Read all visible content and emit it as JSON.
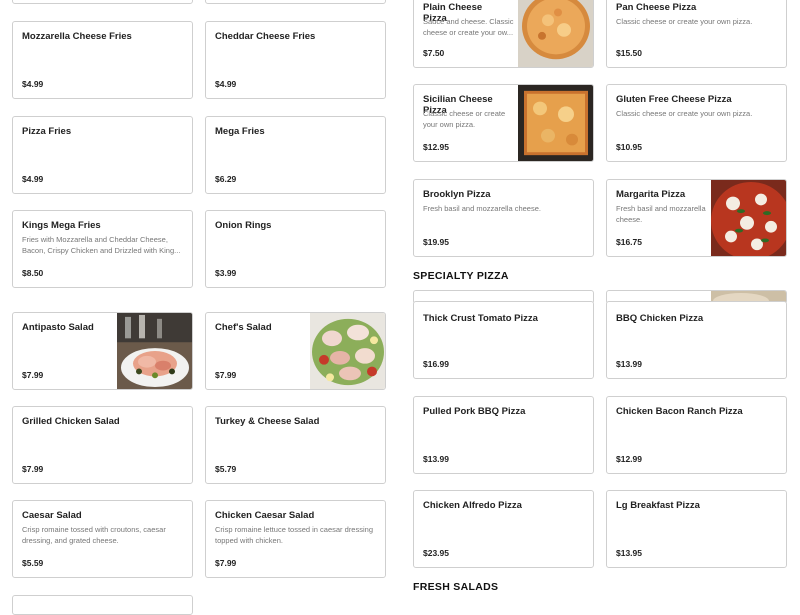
{
  "left_column": [
    {
      "id": "mozzarella-cheese-fries",
      "name": "Mozzarella Cheese Fries",
      "desc": "",
      "price": "$4.99"
    },
    {
      "id": "cheddar-cheese-fries",
      "name": "Cheddar Cheese Fries",
      "desc": "",
      "price": "$4.99"
    },
    {
      "id": "pizza-fries",
      "name": "Pizza Fries",
      "desc": "",
      "price": "$4.99"
    },
    {
      "id": "mega-fries",
      "name": "Mega Fries",
      "desc": "",
      "price": "$6.29"
    },
    {
      "id": "kings-mega-fries",
      "name": "Kings Mega Fries",
      "desc": "Fries with Mozzarella and Cheddar Cheese, Bacon, Crispy Chicken and Drizzled with King...",
      "price": "$8.50"
    },
    {
      "id": "onion-rings",
      "name": "Onion Rings",
      "desc": "",
      "price": "$3.99"
    },
    {
      "id": "antipasto-salad",
      "name": "Antipasto Salad",
      "desc": "",
      "price": "$7.99"
    },
    {
      "id": "chefs-salad",
      "name": "Chef's Salad",
      "desc": "",
      "price": "$7.99"
    },
    {
      "id": "grilled-chicken-salad",
      "name": "Grilled Chicken Salad",
      "desc": "",
      "price": "$7.99"
    },
    {
      "id": "turkey-cheese-salad",
      "name": "Turkey & Cheese Salad",
      "desc": "",
      "price": "$5.79"
    },
    {
      "id": "caesar-salad",
      "name": "Caesar Salad",
      "desc": "Crisp romaine tossed with croutons, caesar dressing, and grated cheese.",
      "price": "$5.59"
    },
    {
      "id": "chicken-caesar-salad",
      "name": "Chicken Caesar Salad",
      "desc": "Crisp romaine lettuce tossed in caesar dressing topped with chicken.",
      "price": "$7.99"
    }
  ],
  "right_column": [
    {
      "id": "plain-cheese-pizza",
      "name": "Plain Cheese Pizza",
      "desc": "Sauce and cheese. Classic cheese or create your ow...",
      "price": "$7.50"
    },
    {
      "id": "pan-cheese-pizza",
      "name": "Pan Cheese Pizza",
      "desc": "Classic cheese or create your own pizza.",
      "price": "$15.50"
    },
    {
      "id": "sicilian-cheese-pizza",
      "name": "Sicilian Cheese Pizza",
      "desc": "Classic cheese or create your own pizza.",
      "price": "$12.95"
    },
    {
      "id": "gluten-free-cheese-pizza",
      "name": "Gluten Free Cheese Pizza",
      "desc": "Classic cheese or create your own pizza.",
      "price": "$10.95"
    },
    {
      "id": "brooklyn-pizza",
      "name": "Brooklyn Pizza",
      "desc": "Fresh basil and mozzarella cheese.",
      "price": "$19.95"
    },
    {
      "id": "margarita-pizza",
      "name": "Margarita Pizza",
      "desc": "Fresh basil and mozzarella cheese.",
      "price": "$16.75"
    }
  ],
  "sections": {
    "specialty": "SPECIALTY PIZZA",
    "fresh_salads": "FRESH SALADS"
  },
  "specialty": [
    {
      "id": "thick-crust-tomato-pizza",
      "name": "Thick Crust Tomato Pizza",
      "price": "$16.99"
    },
    {
      "id": "bbq-chicken-pizza",
      "name": "BBQ Chicken Pizza",
      "price": "$13.99"
    },
    {
      "id": "pulled-pork-bbq-pizza",
      "name": "Pulled Pork BBQ Pizza",
      "price": "$13.99"
    },
    {
      "id": "chicken-bacon-ranch-pizza",
      "name": "Chicken Bacon Ranch Pizza",
      "price": "$12.99"
    },
    {
      "id": "chicken-alfredo-pizza",
      "name": "Chicken Alfredo Pizza",
      "price": "$23.95"
    },
    {
      "id": "lg-breakfast-pizza",
      "name": "Lg Breakfast Pizza",
      "price": "$13.95"
    }
  ]
}
